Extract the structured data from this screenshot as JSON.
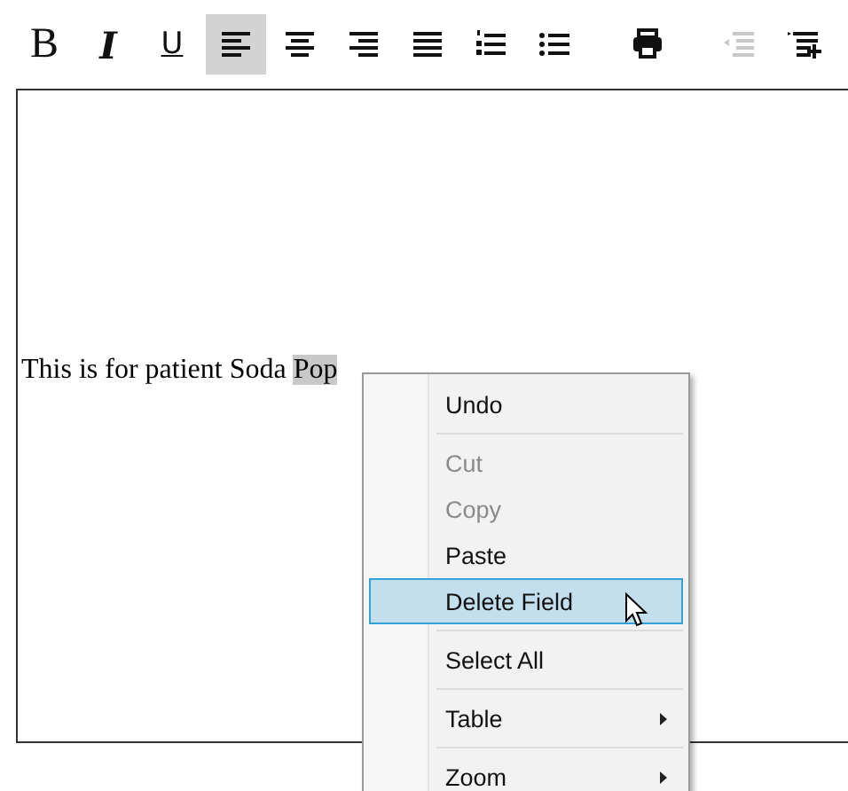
{
  "toolbar": [
    {
      "kind": "bold",
      "label": "B",
      "selected": false,
      "disabled": false
    },
    {
      "kind": "italic",
      "label": "I",
      "selected": false,
      "disabled": false
    },
    {
      "kind": "underline",
      "label": "U",
      "selected": false,
      "disabled": false
    },
    {
      "kind": "align-left",
      "selected": true,
      "disabled": false
    },
    {
      "kind": "align-center",
      "selected": false,
      "disabled": false
    },
    {
      "kind": "align-right",
      "selected": false,
      "disabled": false
    },
    {
      "kind": "justify",
      "selected": false,
      "disabled": false
    },
    {
      "kind": "numbered-list",
      "selected": false,
      "disabled": false
    },
    {
      "kind": "bullet-list",
      "selected": false,
      "disabled": false
    },
    {
      "kind": "print",
      "selected": false,
      "disabled": false
    },
    {
      "kind": "outdent",
      "selected": false,
      "disabled": true
    },
    {
      "kind": "indent",
      "selected": false,
      "disabled": false
    }
  ],
  "editor": {
    "runs": [
      {
        "text": "This is for patient Soda ",
        "field": false
      },
      {
        "text": "Pop",
        "field": true
      }
    ]
  },
  "context_menu": [
    {
      "kind": "item",
      "label": "Undo",
      "disabled": false,
      "selected": false
    },
    {
      "kind": "separator"
    },
    {
      "kind": "item",
      "label": "Cut",
      "disabled": true,
      "selected": false
    },
    {
      "kind": "item",
      "label": "Copy",
      "disabled": true,
      "selected": false
    },
    {
      "kind": "item",
      "label": "Paste",
      "disabled": false,
      "selected": false
    },
    {
      "kind": "item",
      "label": "Delete Field",
      "disabled": false,
      "selected": true
    },
    {
      "kind": "separator"
    },
    {
      "kind": "item",
      "label": "Select All",
      "disabled": false,
      "selected": false
    },
    {
      "kind": "separator"
    },
    {
      "kind": "submenu",
      "label": "Table",
      "disabled": false,
      "selected": false
    },
    {
      "kind": "separator"
    },
    {
      "kind": "submenu",
      "label": "Zoom",
      "disabled": false,
      "selected": false
    }
  ]
}
